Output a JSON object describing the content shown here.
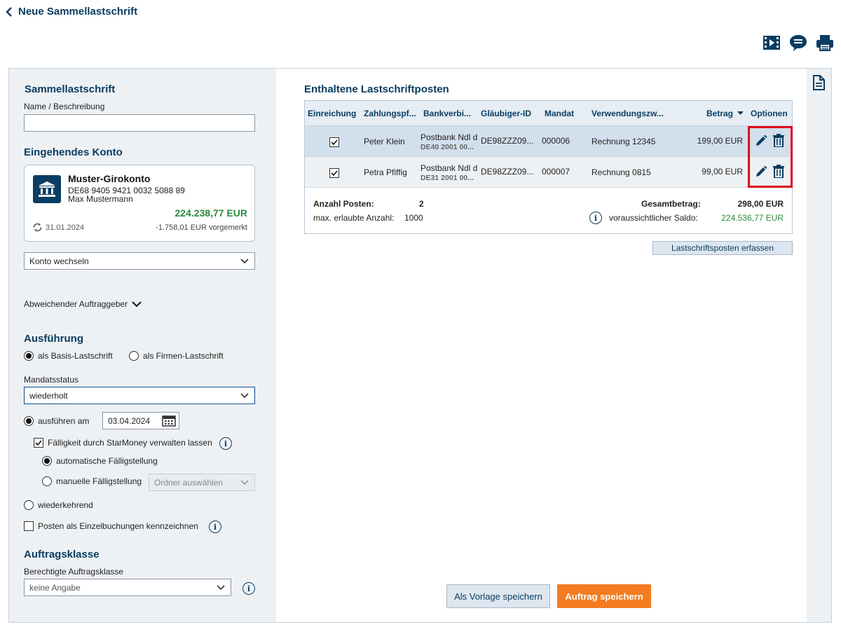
{
  "header": {
    "back_label": "Neue Sammellastschrift"
  },
  "top_icons": [
    "video-icon",
    "chat-icon",
    "print-icon"
  ],
  "left": {
    "section_title": "Sammellastschrift",
    "name_label": "Name / Beschreibung",
    "name_value": "",
    "account_title": "Eingehendes Konto",
    "account": {
      "name": "Muster-Girokonto",
      "iban": "DE68 9405 9421 0032 5088 89",
      "holder": "Max Mustermann",
      "balance": "224.238,77 EUR",
      "date": "31.01.2024",
      "reserved": "-1.758,01 EUR vorgemerkt"
    },
    "switch_account": "Konto wechseln",
    "different_sender": "Abweichender Auftraggeber",
    "execution_title": "Ausführung",
    "radio_basis": "als Basis-Lastschrift",
    "radio_firmen": "als Firmen-Lastschrift",
    "mandate_status_label": "Mandatsstatus",
    "mandate_status_value": "wiederholt",
    "execute_on_label": "ausführen am",
    "execute_on_date": "03.04.2024",
    "due_label": "Fälligkeit durch StarMoney verwalten lassen",
    "auto_due": "automatische Fälligstellung",
    "manual_due": "manuelle Fälligstellung",
    "folder_placeholder": "Ordner auswählen",
    "recurring": "wiederkehrend",
    "single_booking": "Posten als Einzelbuchungen kennzeichnen",
    "order_class_title": "Auftragsklasse",
    "order_class_label": "Berechtigte Auftragsklasse",
    "order_class_value": "keine Angabe"
  },
  "main": {
    "title": "Enthaltene Lastschriftposten",
    "columns": [
      "Einreichung",
      "Zahlungspf...",
      "Bankverbi...",
      "Gläubiger-ID",
      "Mandat",
      "Verwendungszw...",
      "Betrag",
      "Optionen"
    ],
    "rows": [
      {
        "payer": "Peter Klein",
        "bank": "Postbank Ndl d",
        "iban": "DE40 2001 00...",
        "creditor": "DE98ZZZ09...",
        "mandate": "000006",
        "purpose": "Rechnung 12345",
        "amount": "199,00 EUR"
      },
      {
        "payer": "Petra Pfiffig",
        "bank": "Postbank Ndl d",
        "iban": "DE31 2001 00...",
        "creditor": "DE98ZZZ09...",
        "mandate": "000007",
        "purpose": "Rechnung 0815",
        "amount": "99,00 EUR"
      }
    ],
    "summary": {
      "count_label": "Anzahl Posten:",
      "count_value": "2",
      "max_label": "max. erlaubte Anzahl:",
      "max_value": "1000",
      "total_label": "Gesamtbetrag:",
      "total_value": "298,00 EUR",
      "saldo_label": "voraussichtlicher Saldo:",
      "saldo_value": "224.536,77 EUR"
    },
    "add_item_button": "Lastschriftsposten erfassen",
    "save_template_button": "Als Vorlage speichern",
    "save_order_button": "Auftrag speichern"
  },
  "colors": {
    "brand": "#0a3d62",
    "accent": "#f47b20",
    "positive": "#2e8b3a",
    "highlight": "#e0001b"
  }
}
